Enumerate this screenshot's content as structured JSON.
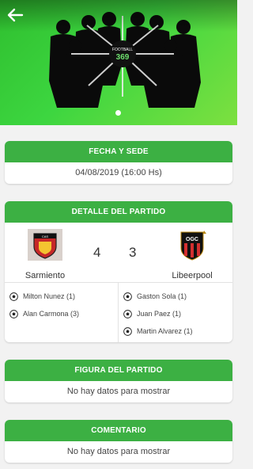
{
  "header": {
    "back_icon": "arrow-left-icon",
    "photo_logo_text": "FOOTBALL",
    "photo_logo_number": "369",
    "carousel_dots": 1
  },
  "date_venue": {
    "title": "FECHA Y SEDE",
    "value": "04/08/2019 (16:00 Hs)"
  },
  "match_detail": {
    "title": "DETALLE DEL PARTIDO",
    "home": {
      "name": "Sarmiento",
      "score": "4",
      "scorers": [
        "Milton Nunez (1)",
        "Alan Carmona (3)"
      ]
    },
    "away": {
      "name": "Libeerpool",
      "score": "3",
      "scorers": [
        "Gaston Sola (1)",
        "Juan Paez (1)",
        "Martin Alvarez (1)"
      ]
    }
  },
  "player_of_match": {
    "title": "FIGURA DEL PARTIDO",
    "value": "No hay datos para mostrar"
  },
  "comment": {
    "title": "COMENTARIO",
    "value": "No hay datos para mostrar"
  },
  "colors": {
    "accent": "#3cb043",
    "background": "#f2f2f2"
  }
}
